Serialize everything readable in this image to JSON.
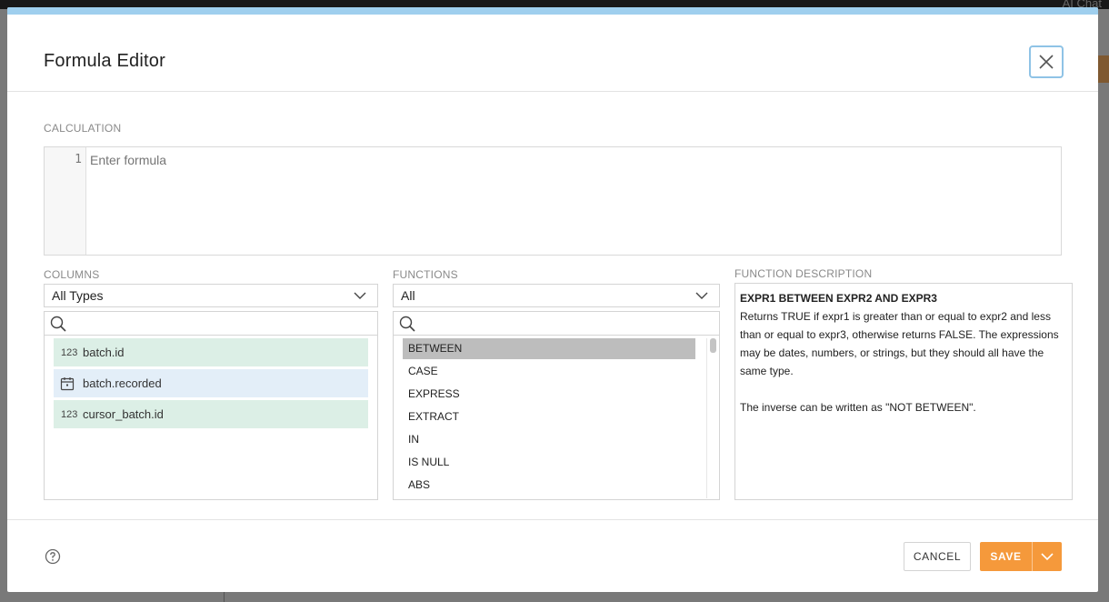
{
  "background": {
    "ai_chat_label": "AI Chat"
  },
  "dialog": {
    "title": "Formula Editor",
    "calculation_label": "CALCULATION",
    "editor": {
      "line_number": "1",
      "placeholder": "Enter formula"
    },
    "columns": {
      "label": "COLUMNS",
      "type_filter": "All Types",
      "search_placeholder": "",
      "items": [
        {
          "type_icon": "number-type-icon",
          "type_text": "123",
          "name": "batch.id"
        },
        {
          "type_icon": "calendar-icon",
          "type_text": "",
          "name": "batch.recorded"
        },
        {
          "type_icon": "number-type-icon",
          "type_text": "123",
          "name": "cursor_batch.id"
        }
      ]
    },
    "functions": {
      "label": "FUNCTIONS",
      "category_filter": "All",
      "search_placeholder": "",
      "items": [
        "BETWEEN",
        "CASE",
        "EXPRESS",
        "EXTRACT",
        "IN",
        "IS NULL",
        "ABS"
      ],
      "selected": "BETWEEN"
    },
    "description": {
      "label": "FUNCTION DESCRIPTION",
      "title": "EXPR1 BETWEEN EXPR2 AND EXPR3",
      "body": "Returns TRUE if expr1 is greater than or equal to expr2 and less than or equal to expr3, otherwise returns FALSE. The expressions may be dates, numbers, or strings, but they should all have the same type.",
      "note": "The inverse can be written as \"NOT BETWEEN\"."
    },
    "footer": {
      "cancel_label": "CANCEL",
      "save_label": "SAVE"
    }
  },
  "colors": {
    "accent_bar": "#9fcfee",
    "save_button": "#f5993b",
    "number_column_bg": "#dcefe6",
    "date_column_bg": "#e3eef8",
    "selected_function_bg": "#bdbdbd"
  }
}
